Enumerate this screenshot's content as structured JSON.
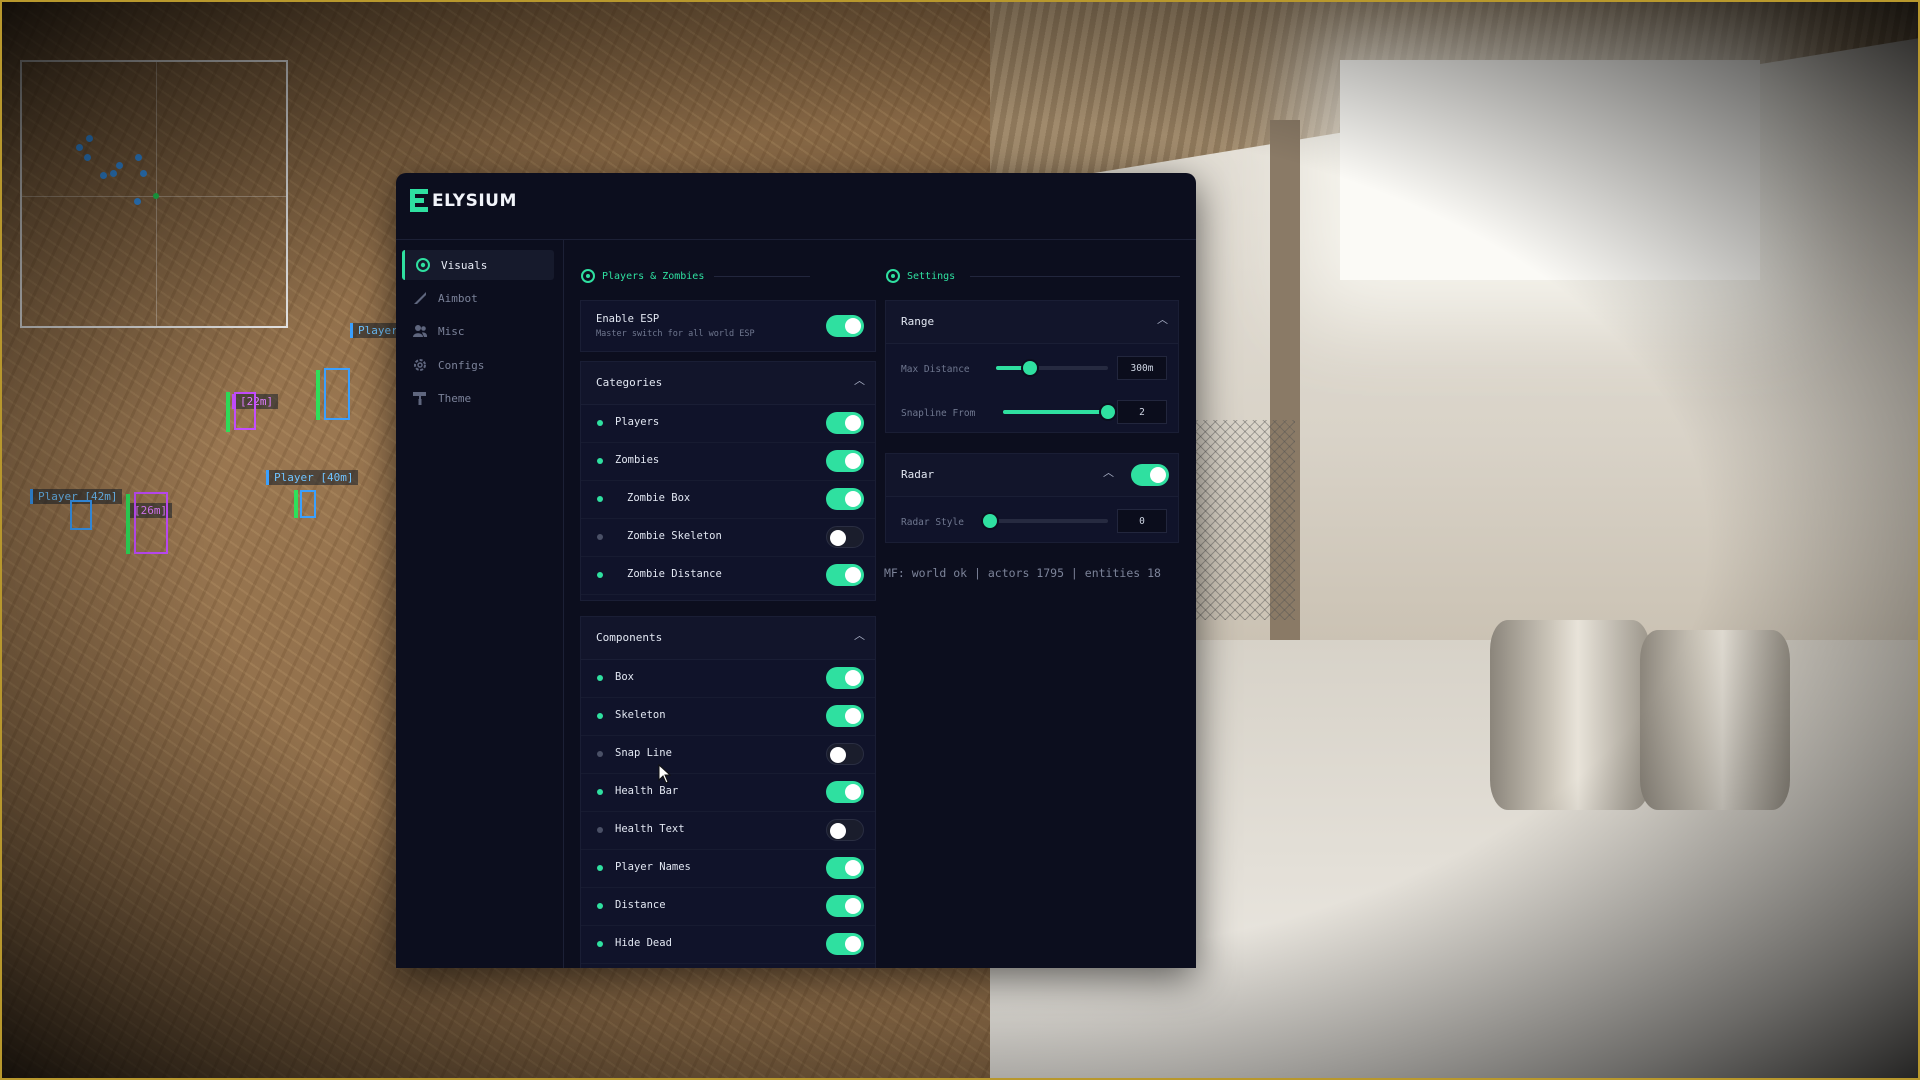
{
  "app": {
    "brand": "ELYSIUM",
    "accent": "#2fe0a0"
  },
  "sidebar": {
    "items": [
      {
        "label": "Visuals",
        "icon": "eye-icon",
        "active": true
      },
      {
        "label": "Aimbot",
        "icon": "rifle-icon",
        "active": false
      },
      {
        "label": "Misc",
        "icon": "users-icon",
        "active": false
      },
      {
        "label": "Configs",
        "icon": "gear-icon",
        "active": false
      },
      {
        "label": "Theme",
        "icon": "paint-roller-icon",
        "active": false
      }
    ]
  },
  "players_section": {
    "title": "Players & Zombies",
    "enable_esp": {
      "label": "Enable ESP",
      "description": "Master switch for all world ESP",
      "on": true
    },
    "categories": {
      "title": "Categories",
      "items": [
        {
          "label": "Players",
          "on": true
        },
        {
          "label": "Zombies",
          "on": true
        },
        {
          "label": "Zombie Box",
          "on": true
        },
        {
          "label": "Zombie Skeleton",
          "on": false
        },
        {
          "label": "Zombie Distance",
          "on": true
        }
      ]
    },
    "components": {
      "title": "Components",
      "items": [
        {
          "label": "Box",
          "on": true
        },
        {
          "label": "Skeleton",
          "on": true
        },
        {
          "label": "Snap Line",
          "on": false
        },
        {
          "label": "Health Bar",
          "on": true
        },
        {
          "label": "Health Text",
          "on": false
        },
        {
          "label": "Player Names",
          "on": true
        },
        {
          "label": "Distance",
          "on": true
        },
        {
          "label": "Hide Dead",
          "on": true
        }
      ]
    }
  },
  "settings_section": {
    "title": "Settings",
    "range": {
      "title": "Range",
      "max_distance": {
        "label": "Max Distance",
        "value": "300m",
        "fraction": 0.3
      },
      "snapline_from": {
        "label": "Snapline From",
        "value": "2",
        "fraction": 1.0
      }
    },
    "radar": {
      "title": "Radar",
      "on": true,
      "radar_style": {
        "label": "Radar Style",
        "value": "0",
        "fraction": 0.0
      }
    },
    "status": "MF: world ok | actors 1795 | entities 18"
  },
  "esp": {
    "tags": [
      {
        "text": "Player",
        "color": "blue"
      },
      {
        "text": "[22m]",
        "color": "pink"
      },
      {
        "text": "Player [40m]",
        "color": "blue"
      },
      {
        "text": "Player [42m]",
        "color": "blue"
      },
      {
        "text": "[26m]",
        "color": "pink"
      }
    ]
  }
}
